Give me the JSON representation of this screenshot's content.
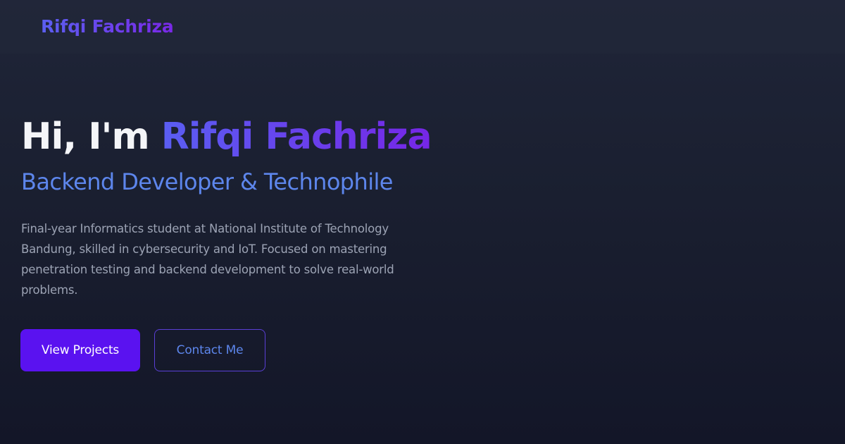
{
  "navbar": {
    "brand": "Rifqi Fachriza"
  },
  "hero": {
    "greeting": "Hi, I'm ",
    "name": "Rifqi Fachriza",
    "subtitle": "Backend Developer & Technophile",
    "description": "Final-year Informatics student at National Institute of Technology Bandung, skilled in cybersecurity and IoT. Focused on mastering penetration testing and backend development to solve real-world problems.",
    "buttons": {
      "primary_label": "View Projects",
      "secondary_label": "Contact Me"
    }
  },
  "colors": {
    "background_top": "#1f2538",
    "background_bottom": "#131628",
    "accent_gradient_start": "#5a5ef2",
    "accent_gradient_end": "#7626e6",
    "subtitle": "#5d86ec",
    "primary_button": "#5a12f0",
    "secondary_button_border": "#5a3fd6"
  }
}
